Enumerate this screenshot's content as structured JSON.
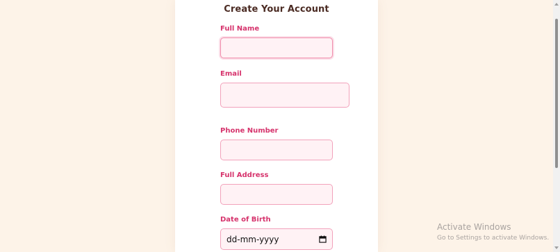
{
  "form": {
    "title": "Create Your Account",
    "fields": {
      "full_name": {
        "label": "Full Name",
        "value": ""
      },
      "email": {
        "label": "Email",
        "value": ""
      },
      "phone": {
        "label": "Phone Number",
        "value": ""
      },
      "address": {
        "label": "Full Address",
        "value": ""
      },
      "dob": {
        "label": "Date of Birth",
        "placeholder": "dd-mm-yyyy",
        "icon": "calendar-icon"
      }
    }
  },
  "watermark": {
    "title": "Activate Windows",
    "subtitle": "Go to Settings to activate Windows."
  },
  "colors": {
    "page_background": "#fdf3e8",
    "card_background": "#ffffff",
    "title": "#4b2b23",
    "label_accent": "#d6336c",
    "field_background": "#fff2f5",
    "field_border": "#f2a2bb"
  }
}
